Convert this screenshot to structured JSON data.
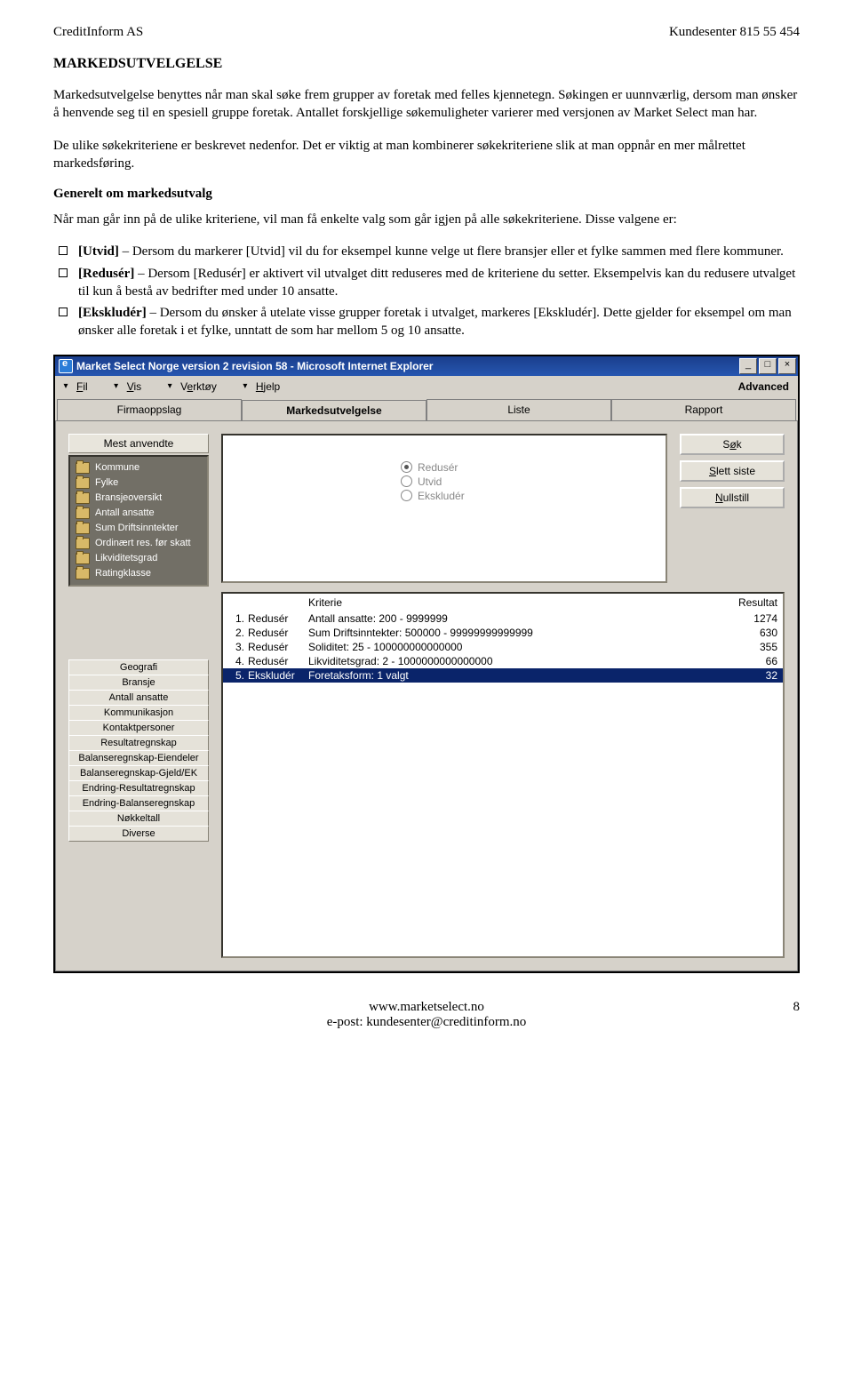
{
  "header": {
    "left": "CreditInform AS",
    "right": "Kundesenter 815 55 454"
  },
  "title": "MARKEDSUTVELGELSE",
  "para1": "Markedsutvelgelse benyttes når man skal søke frem grupper av foretak med felles kjennetegn. Søkingen er uunnværlig, dersom man ønsker å henvende seg til en spesiell gruppe foretak. Antallet forskjellige søkemuligheter varierer med versjonen av Market Select man har.",
  "para2": "De ulike søkekriteriene er beskrevet nedenfor. Det er viktig at man kombinerer søkekriteriene slik at man oppnår en mer målrettet markedsføring.",
  "subhead": "Generelt om markedsutvalg",
  "para3": "Når man går inn på de ulike kriteriene, vil man få enkelte valg som går igjen på alle søkekriteriene. Disse valgene er:",
  "bullets": [
    {
      "bold": "[Utvid]",
      "text": " – Dersom du markerer [Utvid] vil du for eksempel kunne velge ut flere bransjer eller et fylke sammen med flere kommuner."
    },
    {
      "bold": "[Redusér]",
      "text": " – Dersom [Redusér] er aktivert vil utvalget ditt reduseres med de kriteriene du setter. Eksempelvis kan du redusere utvalget til kun å bestå av bedrifter med under 10 ansatte."
    },
    {
      "bold": "[Ekskludér]",
      "text": " – Dersom du ønsker å utelate visse grupper foretak i utvalget, markeres [Ekskludér]. Dette gjelder for eksempel om man ønsker alle foretak i et fylke, unntatt de som har mellom 5 og 10 ansatte."
    }
  ],
  "window": {
    "title": "Market Select Norge version 2 revision 58 - Microsoft Internet Explorer",
    "controls": {
      "min": "_",
      "max": "□",
      "close": "×"
    },
    "menu": [
      "Fil",
      "Vis",
      "Verktøy",
      "Hjelp"
    ],
    "advanced": "Advanced",
    "tabs": [
      "Firmaoppslag",
      "Markedsutvelgelse",
      "Liste",
      "Rapport"
    ],
    "active_tab": 1,
    "sidebar_header": "Mest anvendte",
    "tree": [
      "Kommune",
      "Fylke",
      "Bransjeoversikt",
      "Antall ansatte",
      "Sum Driftsinntekter",
      "Ordinært res. før skatt",
      "Likviditetsgrad",
      "Ratingklasse"
    ],
    "categories": [
      "Geografi",
      "Bransje",
      "Antall ansatte",
      "Kommunikasjon",
      "Kontaktpersoner",
      "Resultatregnskap",
      "Balanseregnskap-Eiendeler",
      "Balanseregnskap-Gjeld/EK",
      "Endring-Resultatregnskap",
      "Endring-Balanseregnskap",
      "Nøkkeltall",
      "Diverse"
    ],
    "radios": [
      {
        "label": "Redusér",
        "selected": true
      },
      {
        "label": "Utvid",
        "selected": false
      },
      {
        "label": "Ekskludér",
        "selected": false
      }
    ],
    "actions": {
      "sok": "Søk",
      "slett": "Slett siste",
      "null": "Nullstill"
    },
    "kriterie_hdr": {
      "k": "Kriterie",
      "r": "Resultat"
    },
    "rows": [
      {
        "n": "1.",
        "mode": "Redusér",
        "text": "Antall ansatte:  200 - 9999999",
        "res": "1274",
        "sel": false
      },
      {
        "n": "2.",
        "mode": "Redusér",
        "text": "Sum Driftsinntekter:  500000 - 99999999999999",
        "res": "630",
        "sel": false
      },
      {
        "n": "3.",
        "mode": "Redusér",
        "text": "Soliditet:  25 - 100000000000000",
        "res": "355",
        "sel": false
      },
      {
        "n": "4.",
        "mode": "Redusér",
        "text": "Likviditetsgrad:  2 - 1000000000000000",
        "res": "66",
        "sel": false
      },
      {
        "n": "5.",
        "mode": "Ekskludér",
        "text": "Foretaksform:  1 valgt",
        "res": "32",
        "sel": true
      }
    ]
  },
  "footer": {
    "l1": "www.marketselect.no",
    "l2": "e-post: kundesenter@creditinform.no",
    "page": "8"
  }
}
